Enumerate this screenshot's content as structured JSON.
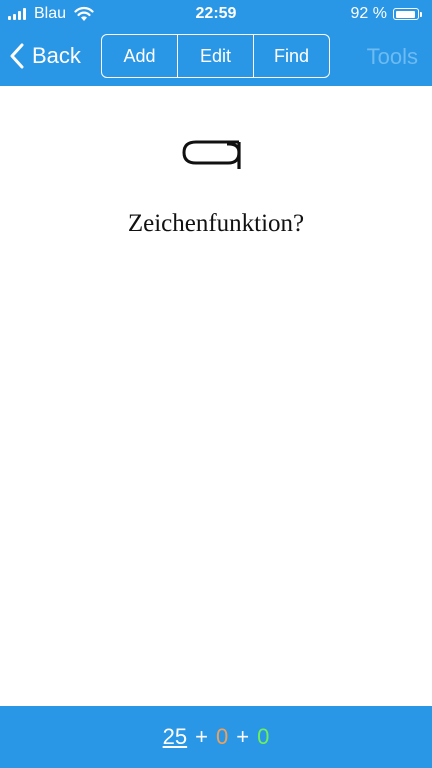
{
  "status_bar": {
    "carrier": "Blau",
    "time": "22:59",
    "battery_percent": "92 %",
    "battery_level": 0.92
  },
  "nav": {
    "back_label": "Back",
    "segments": [
      "Add",
      "Edit",
      "Find"
    ],
    "tools_label": "Tools"
  },
  "card": {
    "glyph_icon": "hieroglyph-rounded-rectangle",
    "prompt": "Zeichenfunktion?"
  },
  "counter": {
    "total": "25",
    "plus": "+",
    "orange": "0",
    "green": "0"
  },
  "colors": {
    "accent": "#2a97e6",
    "tools_disabled": "#6cbbf2",
    "orange": "#f0a058",
    "green": "#6ef05a"
  }
}
